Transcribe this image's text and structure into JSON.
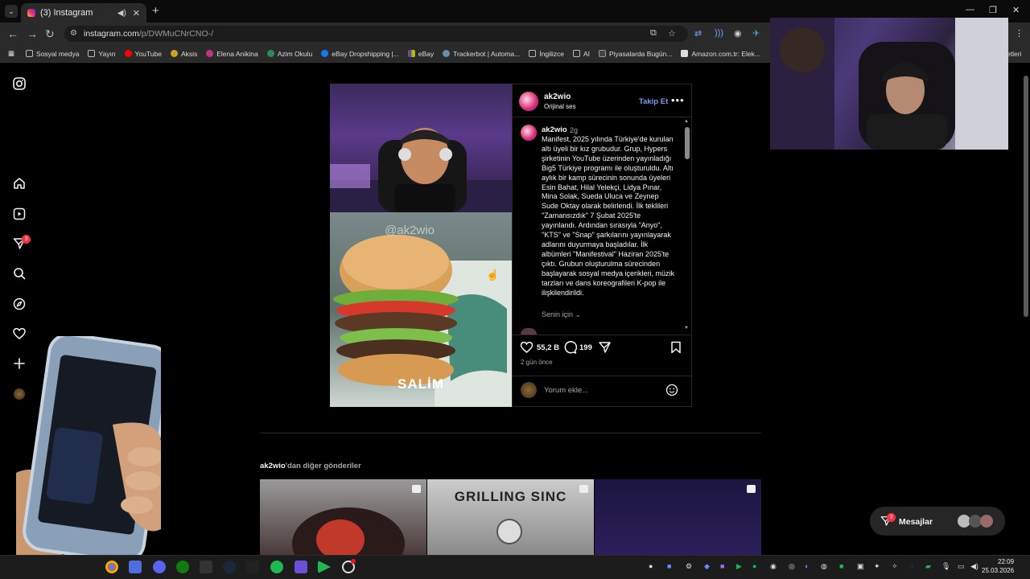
{
  "browser": {
    "tab_title": "(3) Instagram",
    "url_host": "instagram.com",
    "url_path": "/p/DWMuCNrCNO-/",
    "bookmarks": [
      {
        "label": "Sosyal medya",
        "color": "#888888"
      },
      {
        "label": "Yayın",
        "color": "#888888"
      },
      {
        "label": "YouTube",
        "color": "#ff0000"
      },
      {
        "label": "Aksis",
        "color": "#c9a227"
      },
      {
        "label": "Elena Anikina",
        "color": "#c13584"
      },
      {
        "label": "Azim Okulu",
        "color": "#2e8b57"
      },
      {
        "label": "eBay Dropshipping |...",
        "color": "#1877f2"
      },
      {
        "label": "eBay",
        "color": "#e53238"
      },
      {
        "label": "Trackerbot | Automa...",
        "color": "#6a8caf"
      },
      {
        "label": "İngilizce",
        "color": "#888888"
      },
      {
        "label": "AI",
        "color": "#888888"
      },
      {
        "label": "Piyasalarda Bugün...",
        "color": "#333333"
      },
      {
        "label": "Amazon.com.tr: Elek...",
        "color": "#dddddd"
      }
    ],
    "bookmarks_overflow": "etleri"
  },
  "sidebar": {
    "icons": [
      "instagram-logo-icon",
      "home-icon",
      "reels-icon",
      "direct-icon",
      "search-icon",
      "explore-icon",
      "heart-icon",
      "create-icon",
      "profile-avatar"
    ],
    "direct_badge": "3"
  },
  "post": {
    "owner": "ak2wio",
    "audio": "Orijinal ses",
    "follow_label": "Takip Et",
    "caption_user": "ak2wio",
    "caption_time": "2g",
    "caption": "Manifest, 2025 yılında Türkiye'de kurulan altı üyeli bir kız grubudur. Grup, Hypers şirketinin YouTube üzerinden yayınladığı Big5 Türkiye programı ile oluşturuldu. Altı aylık bir kamp sürecinin sonunda üyeleri Esin Bahat, Hilal Yelekçi, Lidya Pınar, Mina Solak, Sueda Uluca ve Zeynep Sude Oktay olarak belirlendi. İlk teklileri \"Zamansızdık\" 7 Şubat 2025'te yayınlandı. Ardından sırasıyla \"Anyo\", \"KTS\" ve \"Snap\" şarkılarını yayınlayarak adlarını duyurmaya başladılar. İlk albümleri \"Manifestival\" Haziran 2025'te çıktı. Grubun oluşturulma sürecinden başlayarak sosyal medya içerikleri, müzik tarzları ve dans koreografileri K-pop ile ilişkilendirildi.",
    "for_you": "Senin için",
    "likes": "55,2 B",
    "comments": "199",
    "posted_ago": "2 gün önce",
    "comment_placeholder": "Yorum ekle...",
    "watermark": "@ak2wio",
    "video_caption": "SALİM"
  },
  "more_posts": {
    "owner": "ak2wio",
    "label": "'dan diğer gönderiler",
    "thumb2_text": "GRILLING SINC"
  },
  "messages": {
    "label": "Mesajlar",
    "badge": "3"
  },
  "taskbar": {
    "time": "22:09",
    "date": "25.03.2026"
  }
}
